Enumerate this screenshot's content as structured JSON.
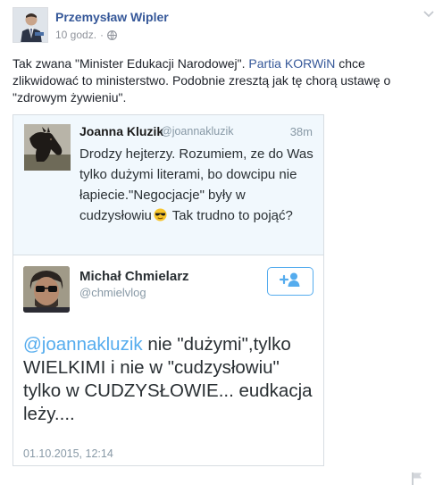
{
  "post": {
    "author": "Przemysław Wipler",
    "timestamp": "10 godz.",
    "separator": "·",
    "text_part1": "Tak zwana \"Minister Edukacji Narodowej\". ",
    "link_text": "Partia KORWiN",
    "text_part2": " chce zlikwidować to ministerstwo. Podobnie zresztą jak tę chorą ustawę o \"zdrowym żywieniu\"."
  },
  "tweet1": {
    "name": "Joanna Kluzik",
    "handle": "@joannakluzik",
    "time": "38m",
    "text_before_emoji": "Drodzy hejterzy. Rozumiem, ze do Was tylko dużymi literami, bo dowcipu nie łapiecie.\"Negocjacje\" były w cudzysłowiu",
    "text_after_emoji": " Tak trudno to pojąć?"
  },
  "tweet2": {
    "name": "Michał Chmielarz",
    "handle": "@chmielvlog",
    "mention": "@joannakluzik",
    "body": " nie \"dużymi\",tylko WIELKIMI i nie w \"cudzysłowiu\" tylko w CUDZYSŁOWIE... eudkacja leży....",
    "date": "01.10.2015, 12:14"
  },
  "icons": {
    "privacy": "globe-icon",
    "options": "chevron-down-icon",
    "follow": "add-user-icon",
    "report": "flag-icon",
    "emoji": "sunglasses-emoji"
  },
  "colors": {
    "facebook_link": "#365899",
    "twitter_blue": "#55acee",
    "muted": "#90949c"
  }
}
